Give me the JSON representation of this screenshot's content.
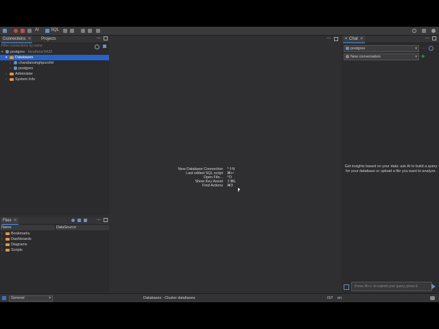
{
  "toolbar": {
    "sql_label": "SQL",
    "ai_label": "AI"
  },
  "left": {
    "tabs": [
      {
        "label": "Connections"
      },
      {
        "label": "Projects"
      }
    ],
    "filter_placeholder": "Filter connections by name",
    "tree": {
      "connection": {
        "name": "postgres",
        "host": "localhost:5432"
      },
      "databases_label": "Databases",
      "db1": "chandansinghpurohit",
      "db2": "postgres",
      "administer": "Administer",
      "system_info": "System Info"
    }
  },
  "files": {
    "tab_label": "Files",
    "col_name": "Name",
    "col_datasource": "DataSource",
    "items": [
      {
        "label": "Bookmarks"
      },
      {
        "label": "Dashboards"
      },
      {
        "label": "Diagrams"
      },
      {
        "label": "Scripts"
      }
    ]
  },
  "editor": {
    "hints": [
      {
        "label": "New Database Connection",
        "key": "^⇧N"
      },
      {
        "label": "Last edited SQL script",
        "key": "⌘↩"
      },
      {
        "label": "Open File...",
        "key": "^O"
      },
      {
        "label": "Show Key Assist",
        "key": "⇧⌘L"
      },
      {
        "label": "Find Actions",
        "key": "⌘3"
      }
    ]
  },
  "chat": {
    "tab_label": "Chat",
    "connection_select": "postgres",
    "conversation_select": "New conversation",
    "info_text": "Get insights based on your data: ask AI to build a query for your database or upload a file you want to analyze.",
    "input_placeholder": "Press ⌘+↩ to submit your query, press E"
  },
  "status": {
    "perspective": "General",
    "center": "Databases - Cluster databases",
    "timezone": "IST",
    "locale": "en"
  },
  "colors": {
    "accent": "#2563c9",
    "folder": "#e4954a",
    "panel": "#2b2b2d"
  }
}
